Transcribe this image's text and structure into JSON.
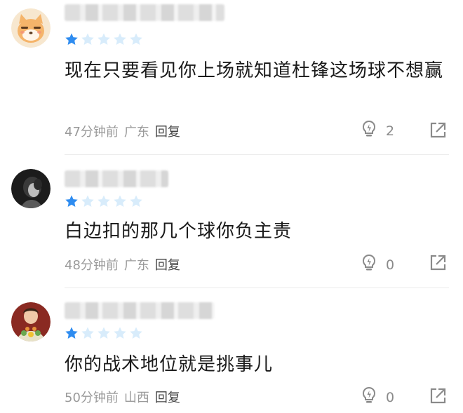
{
  "comments": [
    {
      "rating": 1,
      "text": "现在只要看见你上场就知道杜锋这场球不想赢",
      "time": "47分钟前",
      "location": "广东",
      "reply_label": "回复",
      "likes": "2"
    },
    {
      "rating": 1,
      "text": "白边扣的那几个球你负主责",
      "time": "48分钟前",
      "location": "广东",
      "reply_label": "回复",
      "likes": "0"
    },
    {
      "rating": 1,
      "text": "你的战术地位就是挑事儿",
      "time": "50分钟前",
      "location": "山西",
      "reply_label": "回复",
      "likes": "0"
    }
  ],
  "colors": {
    "star_filled": "#2e8cf0",
    "star_empty": "#d8ecfb",
    "meta_text": "#9a9a9a"
  },
  "icons": [
    "lightbulb-like-icon",
    "share-icon",
    "star-icon"
  ]
}
